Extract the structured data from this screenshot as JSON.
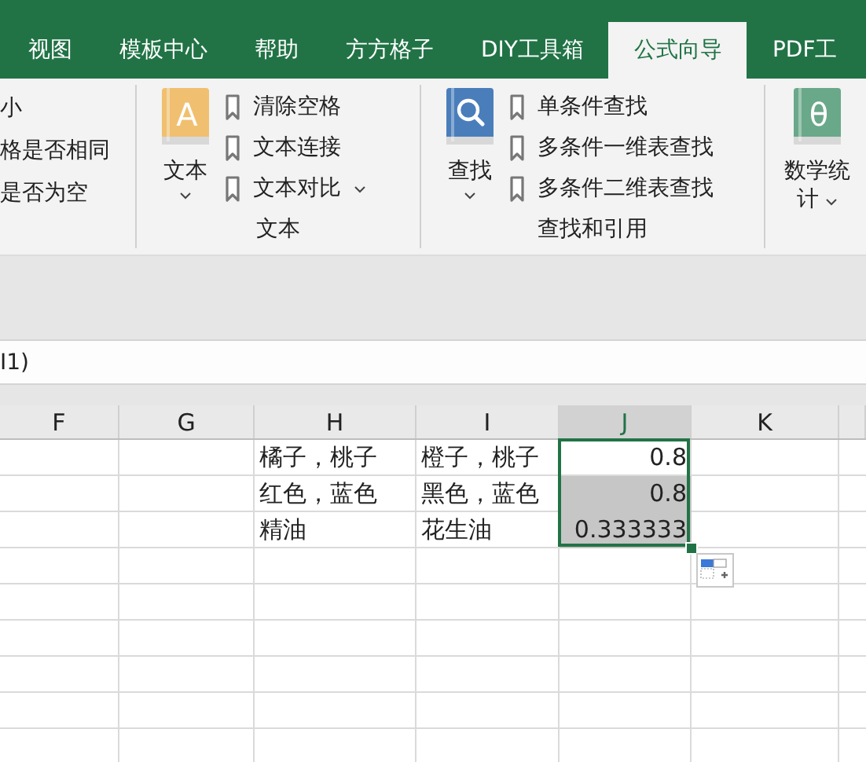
{
  "tabs": [
    {
      "label": "视图",
      "selected": false
    },
    {
      "label": "模板中心",
      "selected": false
    },
    {
      "label": "帮助",
      "selected": false
    },
    {
      "label": "方方格子",
      "selected": false
    },
    {
      "label": "DIY工具箱",
      "selected": false
    },
    {
      "label": "公式向导",
      "selected": true
    },
    {
      "label": "PDF工",
      "selected": false
    }
  ],
  "ribbon": {
    "partial_group": {
      "items": [
        "小",
        "格是否相同",
        "是否为空"
      ]
    },
    "groups": [
      {
        "label": "文本",
        "button": {
          "label": "文本",
          "glyph": "A",
          "color": "#f0c070"
        },
        "items": [
          "清除空格",
          "文本连接",
          "文本对比"
        ],
        "more": true
      },
      {
        "label": "查找和引用",
        "button": {
          "label": "查找",
          "color": "#4a7ebb"
        },
        "items": [
          "单条件查找",
          "多条件一维表查找",
          "多条件二维表查找"
        ],
        "more": false
      },
      {
        "button": {
          "label": "数学统",
          "label_2": "计",
          "glyph": "θ",
          "color": "#6aa88a"
        }
      }
    ]
  },
  "formula_bar": {
    "value": "I1)"
  },
  "columns": [
    {
      "label": "F",
      "selected": false
    },
    {
      "label": "G",
      "selected": false
    },
    {
      "label": "H",
      "selected": false
    },
    {
      "label": "I",
      "selected": false
    },
    {
      "label": "J",
      "selected": true
    },
    {
      "label": "K",
      "selected": false
    }
  ],
  "rows": [
    {
      "cells": [
        null,
        null,
        {
          "text": "橘子，桃子"
        },
        {
          "text": "橙子，桃子"
        },
        {
          "text": "0.8",
          "kind": "number",
          "selected": true,
          "active": true
        },
        null
      ]
    },
    {
      "cells": [
        null,
        null,
        {
          "text": "红色，蓝色"
        },
        {
          "text": "黑色，蓝色"
        },
        {
          "text": "0.8",
          "kind": "number",
          "selected": true,
          "active": false
        },
        null
      ]
    },
    {
      "cells": [
        null,
        null,
        {
          "text": "精油"
        },
        {
          "text": "花生油"
        },
        {
          "text": "0.333333",
          "kind": "number",
          "selected": true,
          "active": false
        },
        null
      ]
    }
  ]
}
